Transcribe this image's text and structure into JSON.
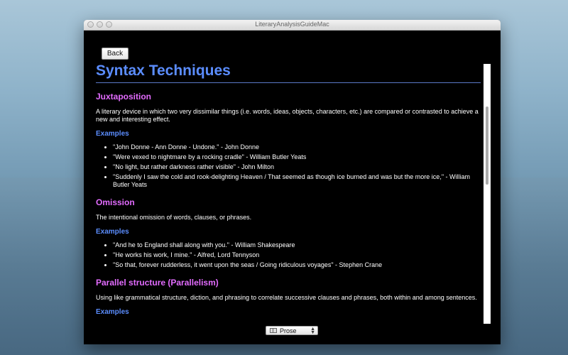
{
  "window": {
    "title": "LiteraryAnalysisGuideMac"
  },
  "toolbar": {
    "back_label": "Back"
  },
  "page": {
    "title": "Syntax Techniques",
    "sections": [
      {
        "heading": "Juxtaposition",
        "definition": "A literary device in which two very dissimilar things (i.e. words, ideas, objects, characters, etc.) are compared or contrasted to achieve a new and interesting effect.",
        "examples_heading": "Examples",
        "examples": [
          "\"John Donne - Ann Donne - Undone.\" - John Donne",
          "\"Were vexed to nightmare by a rocking cradle\" - William Butler Yeats",
          "\"No light, but rather darkness rather visible\" - John Milton",
          "\"Suddenly I saw the cold and rook-delighting Heaven / That seemed as though ice burned and was but the more ice,\" - William Butler Yeats"
        ]
      },
      {
        "heading": "Omission",
        "definition": "The intentional omission of words, clauses, or phrases.",
        "examples_heading": "Examples",
        "examples": [
          "\"And he to England shall along with you.\" - William Shakespeare",
          "\"He works his work, I mine.\" - Alfred, Lord Tennyson",
          "\"So that, forever rudderless, it went upon the seas / Going ridiculous voyages\" - Stephen Crane"
        ]
      },
      {
        "heading": "Parallel structure (Parallelism)",
        "definition": "Using like grammatical structure, diction, and phrasing to correlate successive clauses and phrases, both within and among sentences.",
        "examples_heading": "Examples",
        "examples": []
      }
    ]
  },
  "footer": {
    "genre_select_value": "Prose",
    "genre_icon": "book-icon"
  }
}
